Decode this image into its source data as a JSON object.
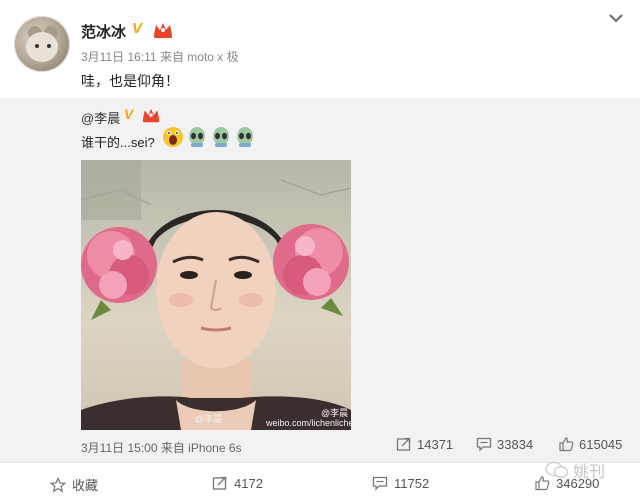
{
  "post": {
    "username": "范冰冰",
    "verified_mark": "V",
    "time_source": "3月11日 16:11 来自 moto x 极",
    "text": "哇，也是仰角！"
  },
  "repost": {
    "original_user": "@李晨",
    "verified_mark": "V",
    "text": "谁干的...sei?",
    "emoji_icons": [
      "scream-face-icon",
      "alien-face-icon",
      "alien-face-icon",
      "alien-face-icon"
    ],
    "image": {
      "watermark_small": "@李晨",
      "watermark_url": "weibo.com/lichenlichen",
      "watermark_user": "@李晨"
    },
    "time_source": "3月11日 15:00 来自 iPhone 6s",
    "stats": {
      "reposts": "14371",
      "comments": "33834",
      "likes": "615045"
    }
  },
  "actions": {
    "favorite_label": "收藏",
    "repost_count": "4172",
    "comment_count": "11752",
    "like_count": "346290"
  },
  "brand": {
    "watermark": "姚刊"
  },
  "colors": {
    "accent_gold": "#f3a612",
    "vip_red": "#e8452c",
    "repost_bg": "#f2f2f5"
  }
}
